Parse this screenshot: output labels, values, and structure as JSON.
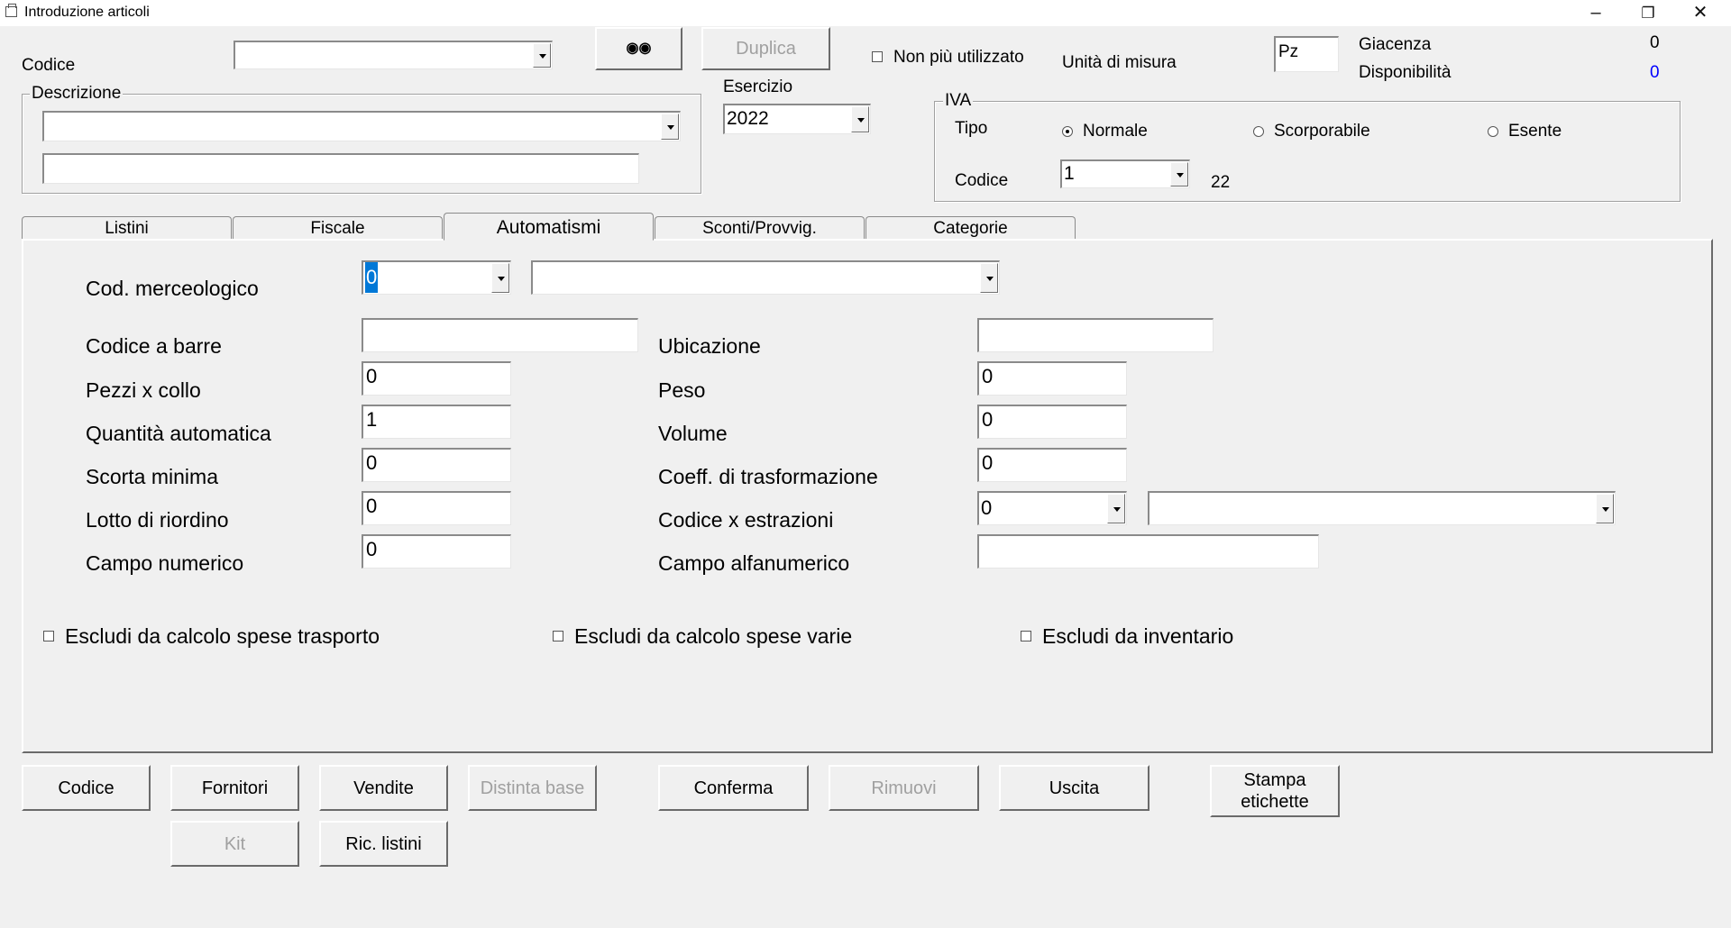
{
  "window": {
    "title": "Introduzione articoli"
  },
  "header": {
    "codice_label": "Codice",
    "codice_value": "",
    "duplica_label": "Duplica",
    "non_piu_utilizzato_label": "Non più utilizzato",
    "unita_misura_label": "Unità di misura",
    "unita_misura_value": "Pz",
    "giacenza_label": "Giacenza",
    "giacenza_value": "0",
    "disponibilita_label": "Disponibilità",
    "disponibilita_value": "0",
    "disponibilita_color": "#0000ff",
    "descrizione_label": "Descrizione",
    "descrizione_value": "",
    "descrizione2_value": "",
    "esercizio_label": "Esercizio",
    "esercizio_value": "2022"
  },
  "iva": {
    "group_label": "IVA",
    "tipo_label": "Tipo",
    "options": [
      "Normale",
      "Scorporabile",
      "Esente"
    ],
    "selected": "Normale",
    "codice_label": "Codice",
    "codice_value": "1",
    "aliquota": "22"
  },
  "tabs": [
    {
      "label": "Listini",
      "active": false
    },
    {
      "label": "Fiscale",
      "active": false
    },
    {
      "label": "Automatismi",
      "active": true
    },
    {
      "label": "Sconti/Provvig.",
      "active": false
    },
    {
      "label": "Categorie",
      "active": false
    }
  ],
  "automatismi": {
    "cod_merceologico_label": "Cod. merceologico",
    "cod_merceologico_value": "0",
    "cod_merceologico_desc": "",
    "codice_barre_label": "Codice a barre",
    "codice_barre_value": "",
    "ubicazione_label": "Ubicazione",
    "ubicazione_value": "",
    "pezzi_collo_label": "Pezzi x collo",
    "pezzi_collo_value": "0",
    "peso_label": "Peso",
    "peso_value": "0",
    "quantita_auto_label": "Quantità automatica",
    "quantita_auto_value": "1",
    "volume_label": "Volume",
    "volume_value": "0",
    "scorta_minima_label": "Scorta minima",
    "scorta_minima_value": "0",
    "coeff_label": "Coeff. di trasformazione",
    "coeff_value": "0",
    "lotto_label": "Lotto di riordino",
    "lotto_value": "0",
    "codice_estrazioni_label": "Codice x estrazioni",
    "codice_estrazioni_value": "0",
    "codice_estrazioni_desc": "",
    "campo_numerico_label": "Campo numerico",
    "campo_numerico_value": "0",
    "campo_alfa_label": "Campo alfanumerico",
    "campo_alfa_value": "",
    "escludi_trasporto_label": "Escludi da calcolo spese trasporto",
    "escludi_varie_label": "Escludi da calcolo spese varie",
    "escludi_inventario_label": "Escludi da inventario"
  },
  "buttons": {
    "codice": "Codice",
    "fornitori": "Fornitori",
    "vendite": "Vendite",
    "distinta_base": "Distinta base",
    "conferma": "Conferma",
    "rimuovi": "Rimuovi",
    "uscita": "Uscita",
    "stampa_etichette_1": "Stampa",
    "stampa_etichette_2": "etichette",
    "kit": "Kit",
    "ric_listini": "Ric. listini"
  }
}
